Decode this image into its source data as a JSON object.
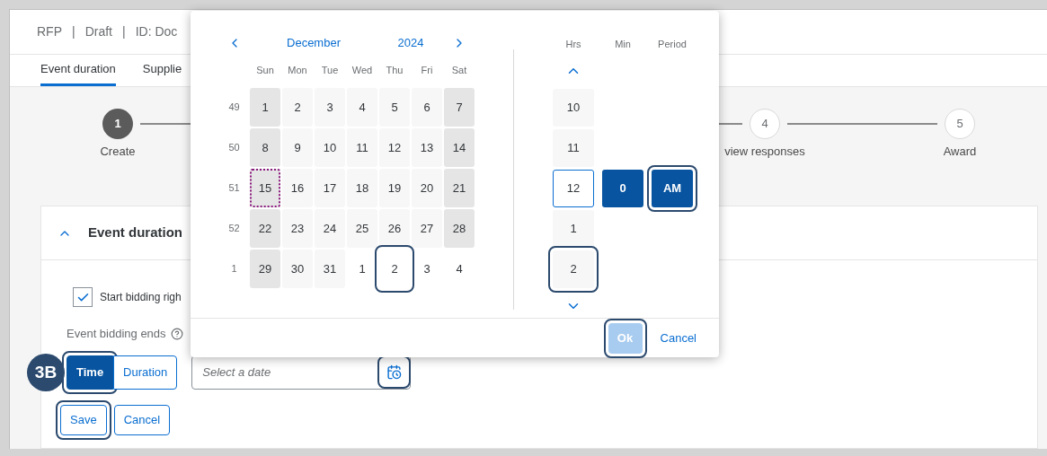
{
  "header": {
    "items": [
      "RFP",
      "|",
      "Draft",
      "|",
      "ID: Doc"
    ]
  },
  "tabs": [
    {
      "label": "Event duration",
      "selected": true
    },
    {
      "label": "Supplie",
      "selected": false
    }
  ],
  "steps": [
    {
      "number": "1",
      "label": "Create",
      "current": true
    },
    {
      "number": "4",
      "label": "view responses",
      "current": false
    },
    {
      "number": "5",
      "label": "Award",
      "current": false
    }
  ],
  "card": {
    "title": "Event duration",
    "expanded": true,
    "start_checkbox": {
      "label": "Start bidding righ",
      "checked": true
    },
    "ends_label": "Event bidding ends",
    "segments": [
      {
        "label": "Time",
        "selected": true,
        "highlighted": true
      },
      {
        "label": "Duration",
        "selected": false,
        "highlighted": false
      }
    ],
    "date_field": {
      "placeholder": "Select a date",
      "icon_highlighted": true
    },
    "buttons": [
      {
        "label": "Save",
        "highlighted": true
      },
      {
        "label": "Cancel",
        "highlighted": false
      }
    ]
  },
  "callout_badge": "3B",
  "popover": {
    "month": "December",
    "year": "2024",
    "weekdays": [
      "Sun",
      "Mon",
      "Tue",
      "Wed",
      "Thu",
      "Fri",
      "Sat"
    ],
    "weeks": [
      {
        "number": "49",
        "days": [
          {
            "day": "1",
            "kind": "weekend",
            "today": false,
            "highlighted": false
          },
          {
            "day": "2",
            "kind": "weekday",
            "today": false,
            "highlighted": false
          },
          {
            "day": "3",
            "kind": "weekday",
            "today": false,
            "highlighted": false
          },
          {
            "day": "4",
            "kind": "weekday",
            "today": false,
            "highlighted": false
          },
          {
            "day": "5",
            "kind": "weekday",
            "today": false,
            "highlighted": false
          },
          {
            "day": "6",
            "kind": "weekday",
            "today": false,
            "highlighted": false
          },
          {
            "day": "7",
            "kind": "weekend",
            "today": false,
            "highlighted": false
          }
        ]
      },
      {
        "number": "50",
        "days": [
          {
            "day": "8",
            "kind": "weekend",
            "today": false,
            "highlighted": false
          },
          {
            "day": "9",
            "kind": "weekday",
            "today": false,
            "highlighted": false
          },
          {
            "day": "10",
            "kind": "weekday",
            "today": false,
            "highlighted": false
          },
          {
            "day": "11",
            "kind": "weekday",
            "today": false,
            "highlighted": false
          },
          {
            "day": "12",
            "kind": "weekday",
            "today": false,
            "highlighted": false
          },
          {
            "day": "13",
            "kind": "weekday",
            "today": false,
            "highlighted": false
          },
          {
            "day": "14",
            "kind": "weekend",
            "today": false,
            "highlighted": false
          }
        ]
      },
      {
        "number": "51",
        "days": [
          {
            "day": "15",
            "kind": "weekend",
            "today": true,
            "highlighted": false
          },
          {
            "day": "16",
            "kind": "weekday",
            "today": false,
            "highlighted": false
          },
          {
            "day": "17",
            "kind": "weekday",
            "today": false,
            "highlighted": false
          },
          {
            "day": "18",
            "kind": "weekday",
            "today": false,
            "highlighted": false
          },
          {
            "day": "19",
            "kind": "weekday",
            "today": false,
            "highlighted": false
          },
          {
            "day": "20",
            "kind": "weekday",
            "today": false,
            "highlighted": false
          },
          {
            "day": "21",
            "kind": "weekend",
            "today": false,
            "highlighted": false
          }
        ]
      },
      {
        "number": "52",
        "days": [
          {
            "day": "22",
            "kind": "weekend",
            "today": false,
            "highlighted": false
          },
          {
            "day": "23",
            "kind": "weekday",
            "today": false,
            "highlighted": false
          },
          {
            "day": "24",
            "kind": "weekday",
            "today": false,
            "highlighted": false
          },
          {
            "day": "25",
            "kind": "weekday",
            "today": false,
            "highlighted": false
          },
          {
            "day": "26",
            "kind": "weekday",
            "today": false,
            "highlighted": false
          },
          {
            "day": "27",
            "kind": "weekday",
            "today": false,
            "highlighted": false
          },
          {
            "day": "28",
            "kind": "weekend",
            "today": false,
            "highlighted": false
          }
        ]
      },
      {
        "number": "1",
        "days": [
          {
            "day": "29",
            "kind": "weekend",
            "today": false,
            "highlighted": false
          },
          {
            "day": "30",
            "kind": "weekday",
            "today": false,
            "highlighted": false
          },
          {
            "day": "31",
            "kind": "weekday",
            "today": false,
            "highlighted": false
          },
          {
            "day": "1",
            "kind": "outside",
            "today": false,
            "highlighted": false
          },
          {
            "day": "2",
            "kind": "outside",
            "today": false,
            "highlighted": true
          },
          {
            "day": "3",
            "kind": "outside",
            "today": false,
            "highlighted": false
          },
          {
            "day": "4",
            "kind": "outside",
            "today": false,
            "highlighted": false
          }
        ]
      }
    ],
    "time_columns": [
      {
        "header": "Hrs",
        "kind": "scroll",
        "items": [
          {
            "value": "10",
            "selected": false,
            "highlighted": false
          },
          {
            "value": "11",
            "selected": false,
            "highlighted": false
          },
          {
            "value": "12",
            "selected": true,
            "highlighted": false
          },
          {
            "value": "1",
            "selected": false,
            "highlighted": false
          },
          {
            "value": "2",
            "selected": false,
            "highlighted": true
          }
        ]
      },
      {
        "header": "Min",
        "kind": "fixed",
        "items": [
          {
            "value": "0",
            "selected": true,
            "highlighted": false
          }
        ]
      },
      {
        "header": "Period",
        "kind": "fixed",
        "items": [
          {
            "value": "AM",
            "selected": true,
            "highlighted": true
          }
        ]
      }
    ],
    "ok": {
      "label": "Ok",
      "disabled": true,
      "highlighted": true
    },
    "cancel": "Cancel"
  }
}
